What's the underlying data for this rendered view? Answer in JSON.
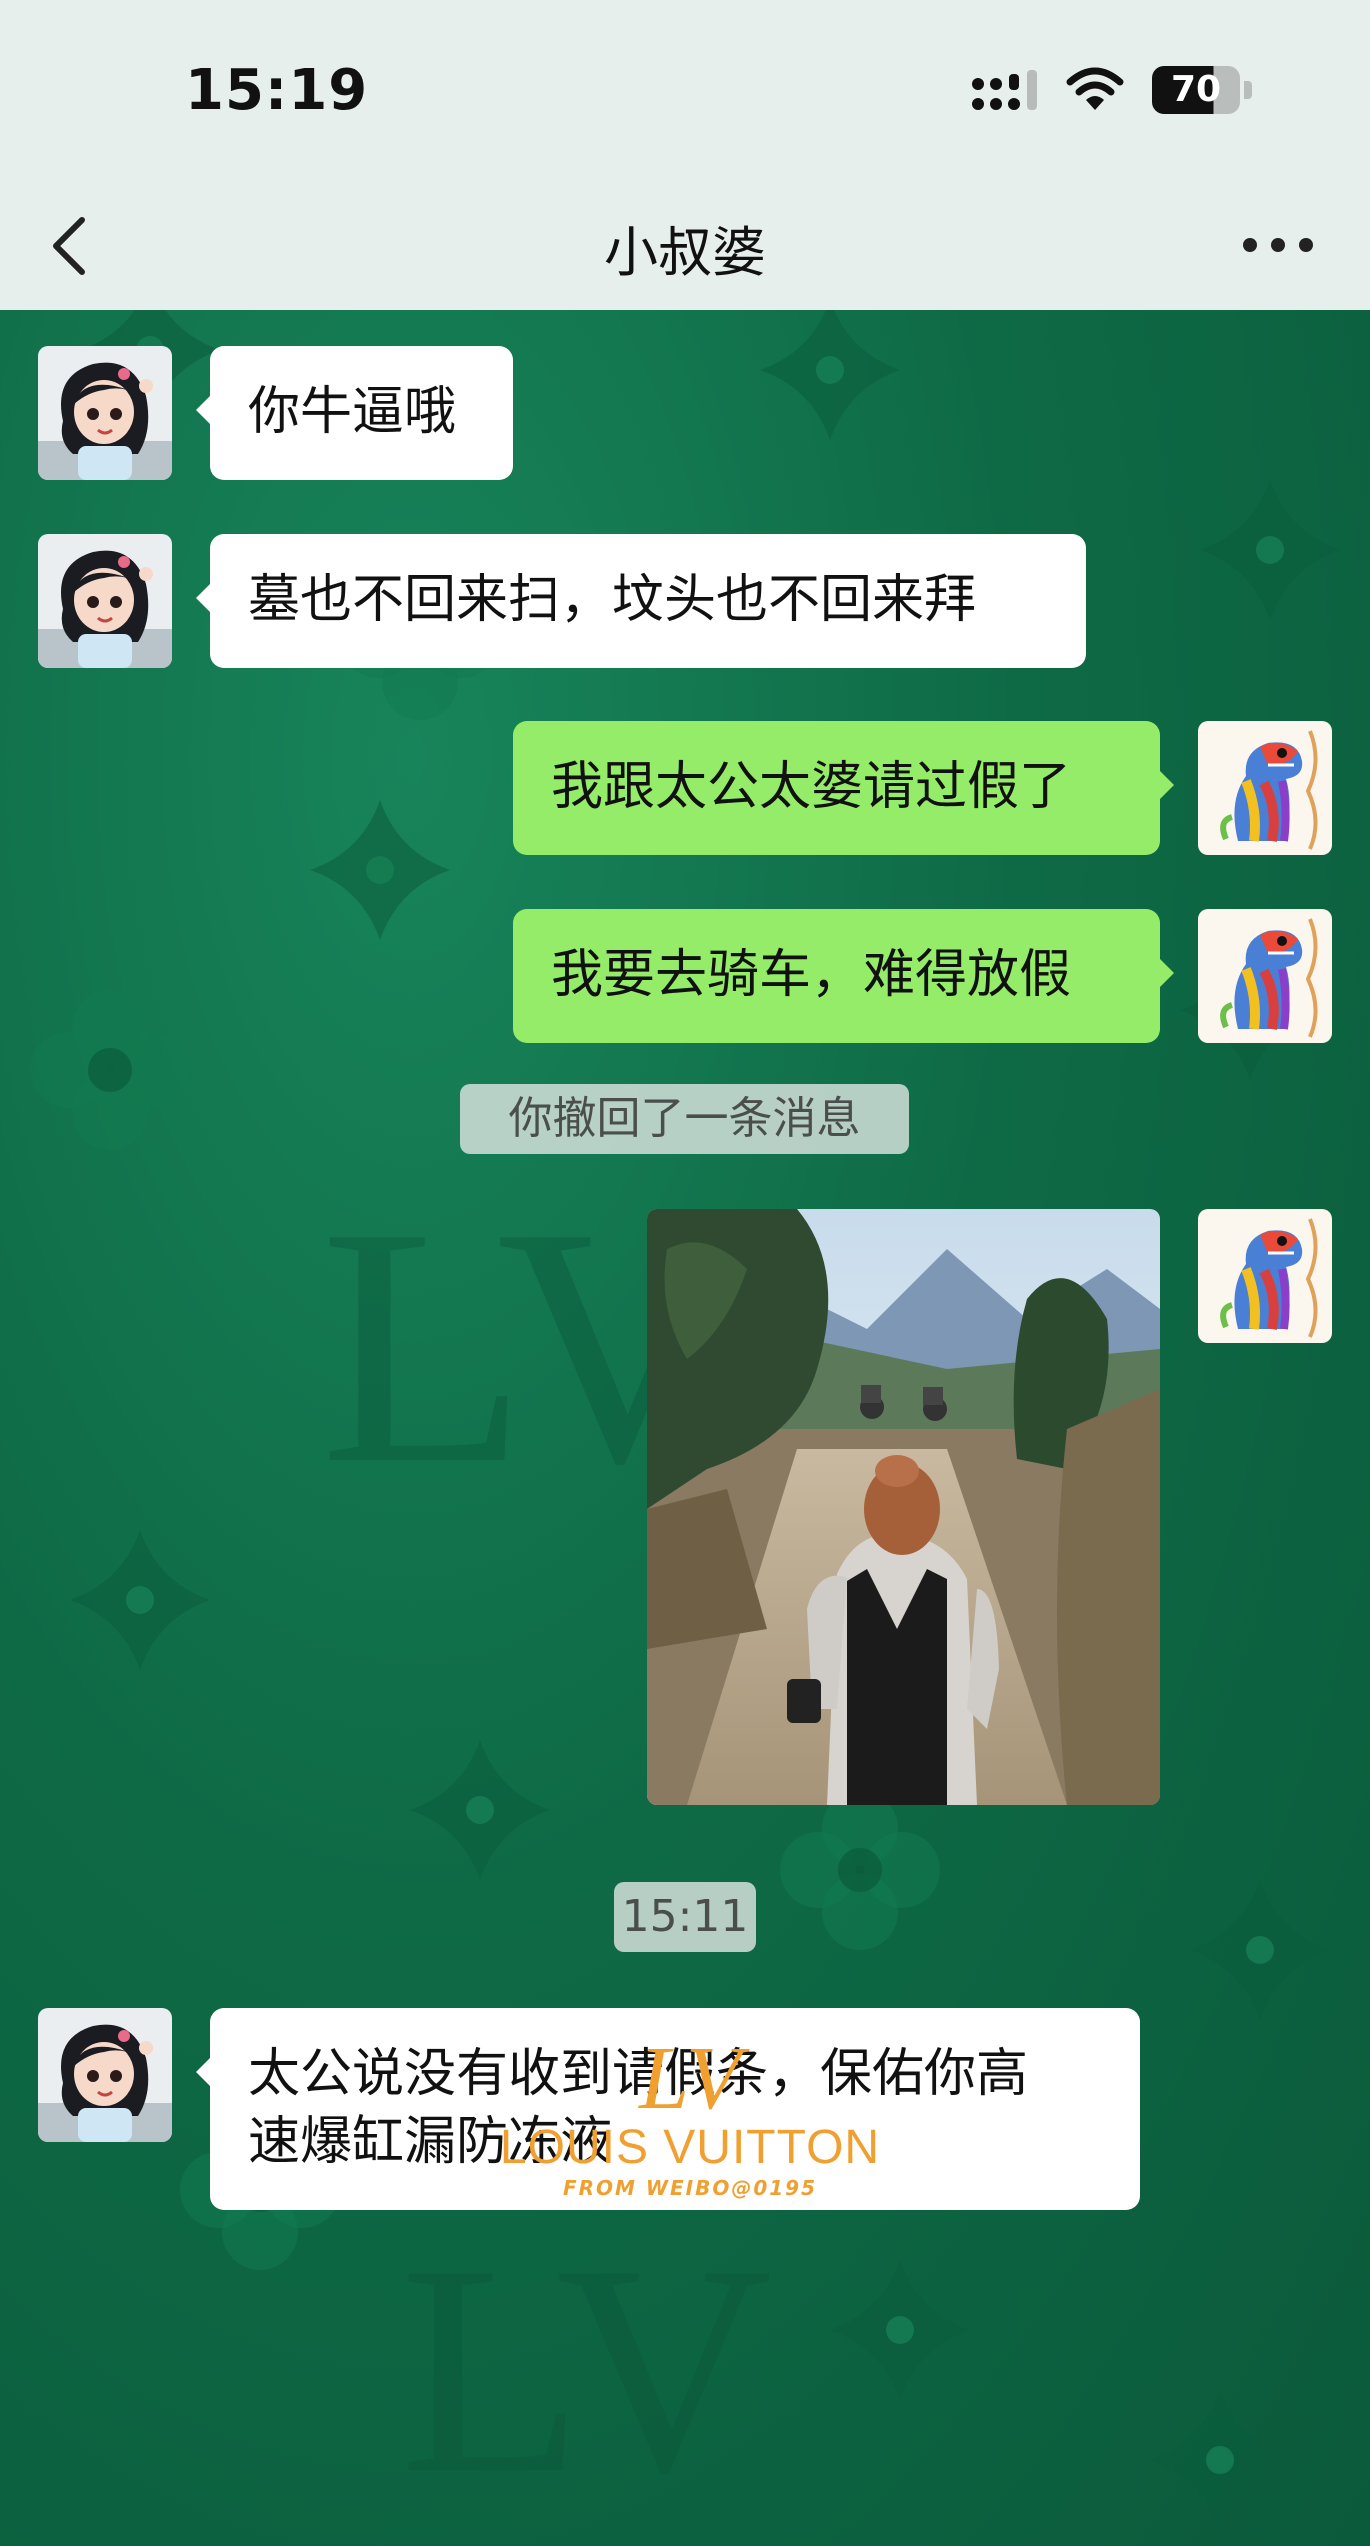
{
  "status_bar": {
    "time": "15:19",
    "battery": "70",
    "icons": [
      "signal-icon",
      "wifi-icon",
      "battery-icon"
    ]
  },
  "nav": {
    "title": "小叔婆",
    "icons": [
      "back-chevron-icon",
      "more-dots-icon"
    ]
  },
  "messages": [
    {
      "side": "left",
      "text": "你牛逼哦"
    },
    {
      "side": "left",
      "text": "墓也不回来扫，坟头也不回来拜"
    },
    {
      "side": "right",
      "text": "我跟太公太婆请过假了"
    },
    {
      "side": "right",
      "text": "我要去骑车，难得放假"
    },
    {
      "side": "system",
      "text": "你撤回了一条消息"
    },
    {
      "side": "right",
      "type": "image"
    },
    {
      "side": "time",
      "text": "15:11"
    },
    {
      "side": "left",
      "lines": [
        "太公说没有收到请假条，保佑你高",
        "速爆缸漏防冻液"
      ]
    }
  ],
  "watermark": {
    "logo": "LV",
    "brand": "LOUIS VUITTON",
    "credit": "FROM WEIBO@0195"
  },
  "colors": {
    "chat_background": "#0f6a47",
    "sent_bubble": "#95ec69",
    "received_bubble": "#ffffff",
    "top_bar": "#e6efec",
    "watermark": "#f0a030"
  }
}
